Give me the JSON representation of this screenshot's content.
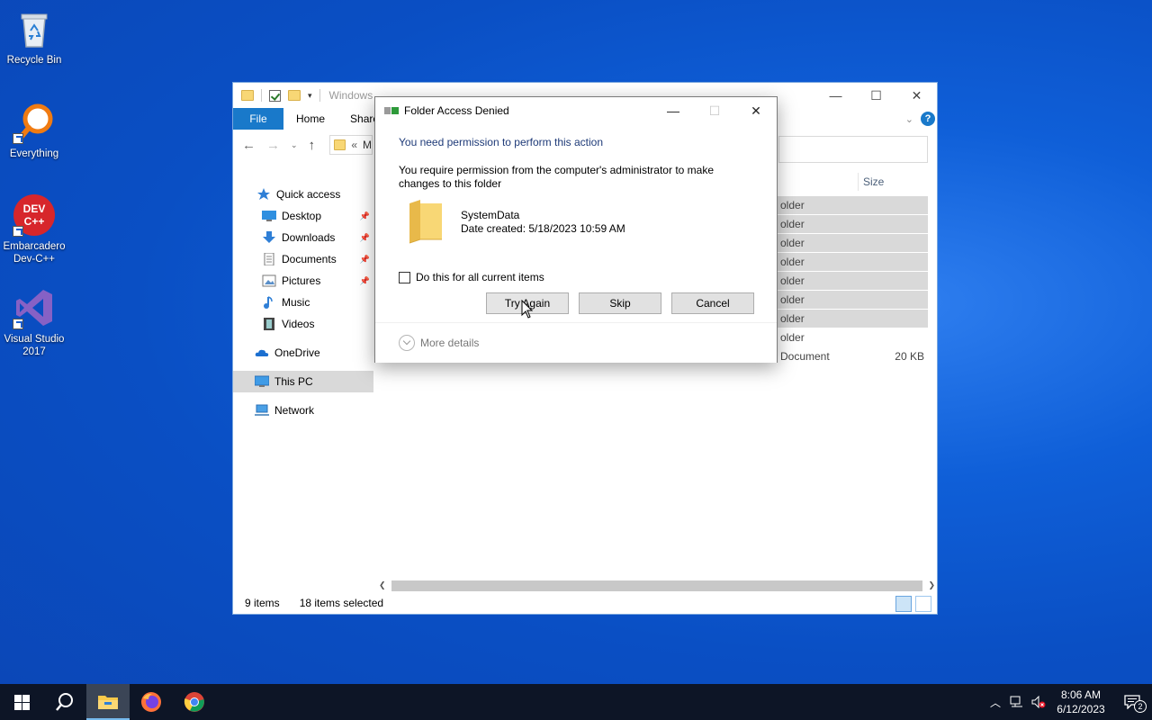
{
  "desktop": {
    "icons": [
      {
        "label": "Recycle Bin"
      },
      {
        "label": "Everything"
      },
      {
        "label": "Embarcadero Dev-C++",
        "badge_text": "DEV C++"
      },
      {
        "label": "Visual Studio 2017"
      }
    ]
  },
  "explorer": {
    "title": "Windows",
    "ribbon_tabs": [
      "File",
      "Home",
      "Share"
    ],
    "address_chevron": "«",
    "address_text": "M",
    "sidebar": {
      "items": [
        {
          "label": "Quick access",
          "icon": "star-icon",
          "pinned": false
        },
        {
          "label": "Desktop",
          "icon": "desktop-icon",
          "pinned": true
        },
        {
          "label": "Downloads",
          "icon": "download-icon",
          "pinned": true
        },
        {
          "label": "Documents",
          "icon": "documents-icon",
          "pinned": true
        },
        {
          "label": "Pictures",
          "icon": "pictures-icon",
          "pinned": true
        },
        {
          "label": "Music",
          "icon": "music-icon",
          "pinned": false
        },
        {
          "label": "Videos",
          "icon": "videos-icon",
          "pinned": false
        },
        {
          "label": "OneDrive",
          "icon": "onedrive-icon",
          "pinned": false
        },
        {
          "label": "This PC",
          "icon": "this-pc-icon",
          "pinned": false
        },
        {
          "label": "Network",
          "icon": "network-icon",
          "pinned": false
        }
      ]
    },
    "column_size": "Size",
    "rows": [
      {
        "type": "older",
        "size": ""
      },
      {
        "type": "older",
        "size": ""
      },
      {
        "type": "older",
        "size": ""
      },
      {
        "type": "older",
        "size": ""
      },
      {
        "type": "older",
        "size": ""
      },
      {
        "type": "older",
        "size": ""
      },
      {
        "type": "older",
        "size": ""
      },
      {
        "type": "older",
        "size": ""
      },
      {
        "type": "Document",
        "size": "20 KB"
      }
    ],
    "status": {
      "items": "9 items",
      "selected": "18 items selected"
    }
  },
  "dialog": {
    "title": "Folder Access Denied",
    "heading": "You need permission to perform this action",
    "message": "You require permission from the computer's administrator to make changes to this folder",
    "folder_name": "SystemData",
    "date_created": "Date created: 5/18/2023 10:59 AM",
    "checkbox_label": "Do this for all current items",
    "buttons": {
      "try_again": "Try Again",
      "skip": "Skip",
      "cancel": "Cancel"
    },
    "more_details": "More details"
  },
  "taskbar": {
    "time": "8:06 AM",
    "date": "6/12/2023",
    "notification_count": "2"
  },
  "colors": {
    "accent": "#1979ca",
    "taskbar": "#0d1526",
    "selection": "#d9d9d9"
  }
}
